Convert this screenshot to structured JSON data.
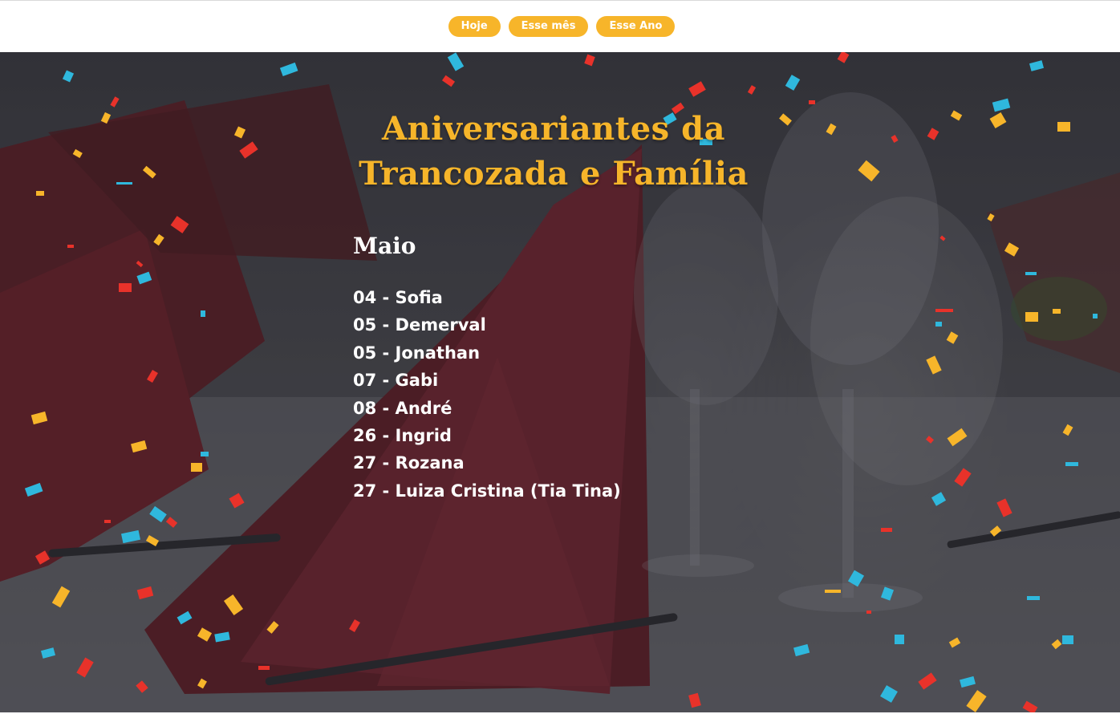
{
  "nav": {
    "today_label": "Hoje",
    "month_label": "Esse mês",
    "year_label": "Esse Ano"
  },
  "hero": {
    "title": "Aniversariantes da Trancozada e Família",
    "month": "Maio",
    "birthdays": [
      "04 - Sofia",
      "05 - Demerval",
      "05 - Jonathan",
      "07 - Gabi",
      "08 - André",
      "26 - Ingrid",
      "27 - Rozana",
      "27 - Luiza Cristina (Tia Tina)"
    ]
  },
  "colors": {
    "accent": "#f7b52a",
    "title": "#f6b52a",
    "text": "#ffffff",
    "confetti_yellow": "#f7b52a",
    "confetti_red": "#e8322a",
    "confetti_blue": "#2fb8dd"
  }
}
